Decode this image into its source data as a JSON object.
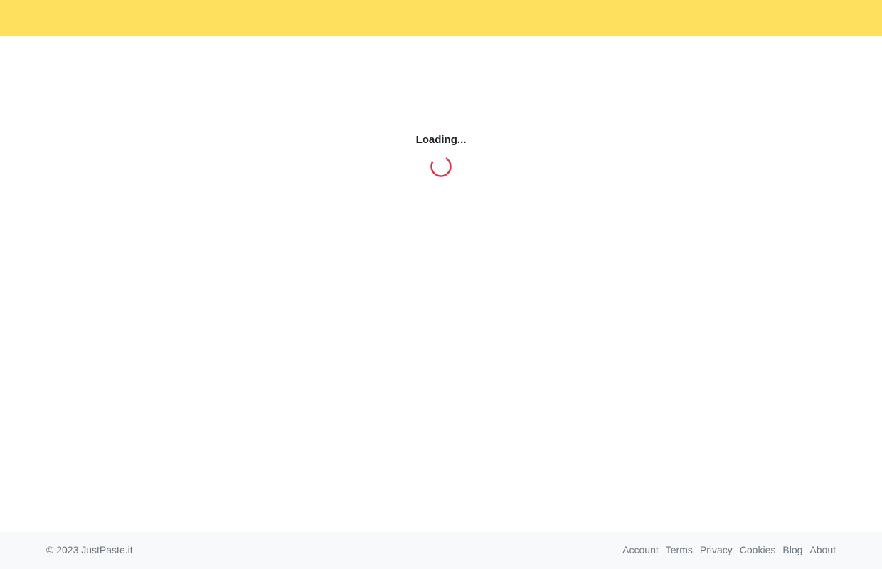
{
  "loading": {
    "text": "Loading..."
  },
  "footer": {
    "copyright_symbol_year": "© 2023",
    "brand": "JustPaste.it",
    "links": [
      {
        "label": "Account"
      },
      {
        "label": "Terms"
      },
      {
        "label": "Privacy"
      },
      {
        "label": "Cookies"
      },
      {
        "label": "Blog"
      },
      {
        "label": "About"
      }
    ]
  },
  "colors": {
    "header_bg": "#ffdf5d",
    "footer_bg": "#f8f9fa",
    "spinner": "#dc3545",
    "footer_text": "#6c757d"
  },
  "icons": {
    "spinner": "loading-spinner-icon"
  }
}
